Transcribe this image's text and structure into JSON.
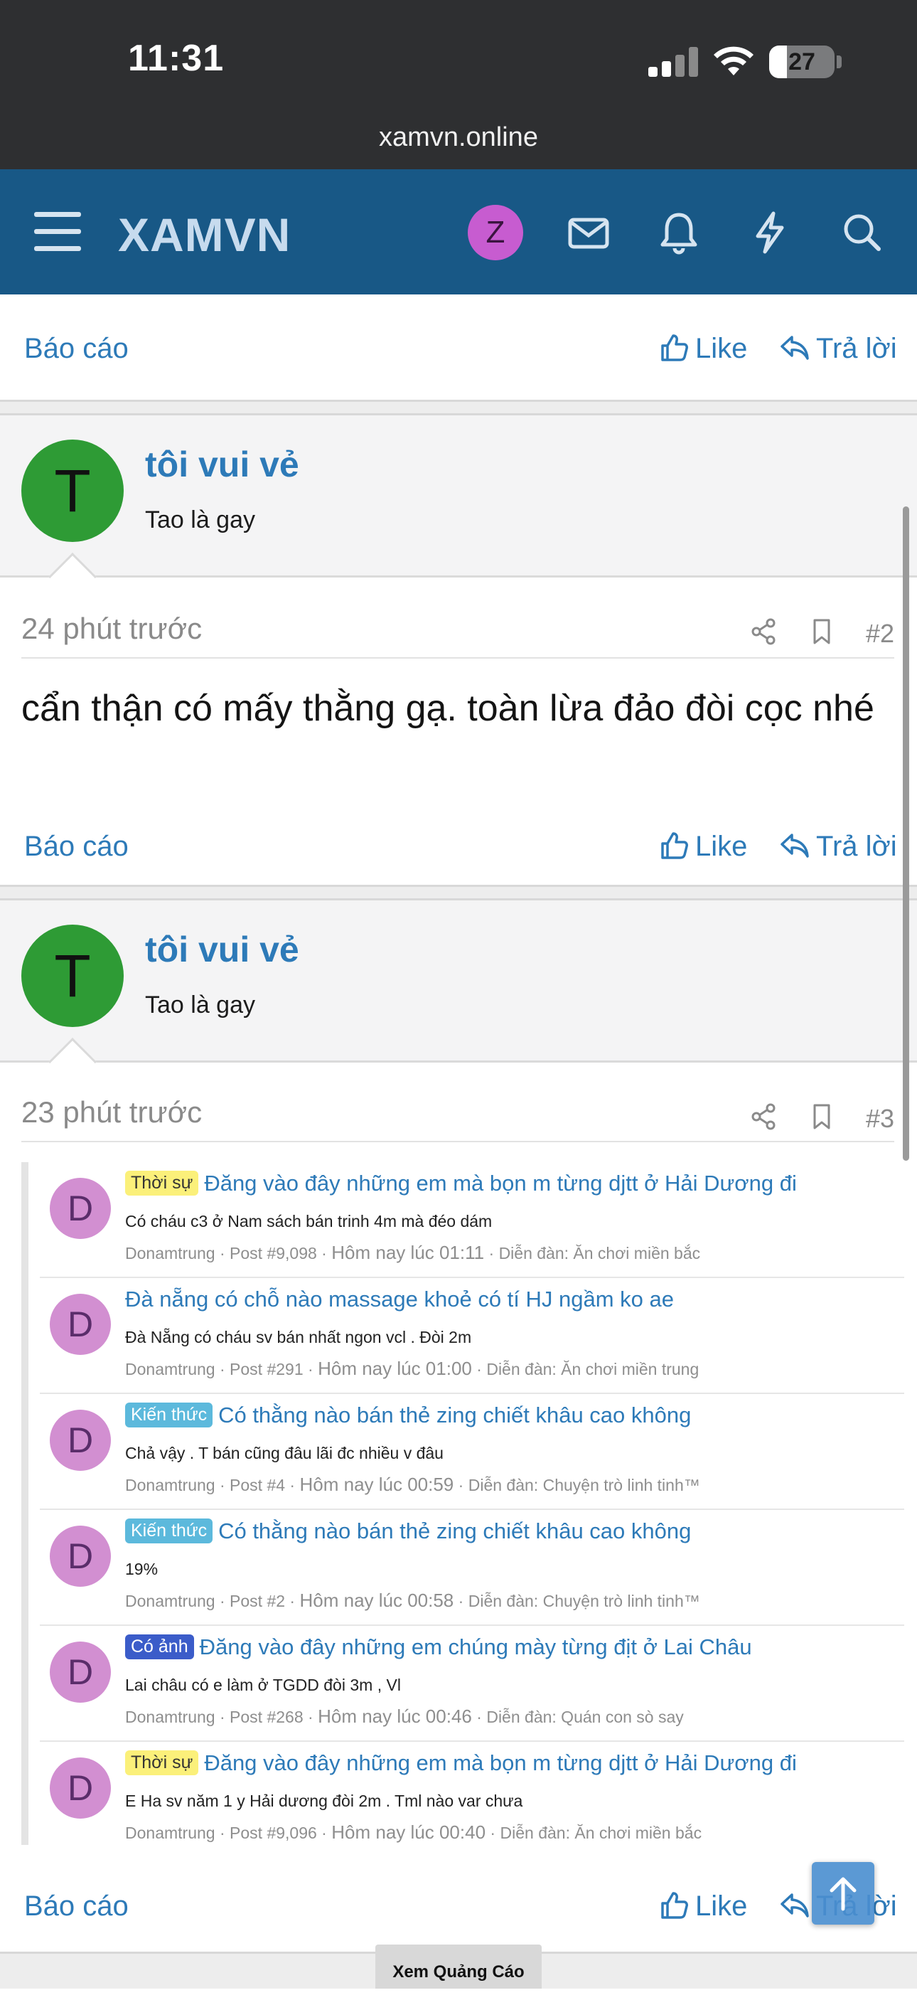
{
  "status": {
    "time": "11:31",
    "battery": "27"
  },
  "browser": {
    "url": "xamvn.online"
  },
  "header": {
    "logo": "XAMVN",
    "avatar_letter": "Z"
  },
  "actions": {
    "report": "Báo cáo",
    "like": "Like",
    "reply": "Trả lời"
  },
  "posts": [
    {
      "user": {
        "name": "tôi vui vẻ",
        "title": "Tao là gay",
        "avatar_letter": "T"
      },
      "time": "24 phút trước",
      "number": "#2",
      "body": "cẩn thận có mấy thằng gạ. toàn lừa đảo đòi cọc nhé"
    },
    {
      "user": {
        "name": "tôi vui vẻ",
        "title": "Tao là gay",
        "avatar_letter": "T"
      },
      "time": "23 phút trước",
      "number": "#3",
      "embed": [
        {
          "prefix": "Thời sự",
          "prefix_style": "thoisu",
          "title": "Đăng vào đây những em mà bọn m từng djtt ở Hải Dương đi",
          "snippet": "Có cháu c3 ở Nam sách bán trinh 4m mà đéo dám",
          "author": "Donamtrung",
          "post": "Post #9,098",
          "time": "Hôm nay lúc 01:11",
          "forum": "Diễn đàn: Ăn chơi miền bắc",
          "avatar_letter": "D"
        },
        {
          "prefix": "",
          "prefix_style": "",
          "title": "Đà nẵng có chỗ nào massage khoẻ có tí HJ ngầm ko ae",
          "snippet": "Đà Nẵng có cháu sv bán nhất ngon vcl . Đòi 2m",
          "author": "Donamtrung",
          "post": "Post #291",
          "time": "Hôm nay lúc 01:00",
          "forum": "Diễn đàn: Ăn chơi miền trung",
          "avatar_letter": "D"
        },
        {
          "prefix": "Kiến thức",
          "prefix_style": "kienthuc",
          "title": "Có thằng nào bán thẻ zing chiết khâu cao không",
          "snippet": "Chả vậy . T bán cũng đâu lãi đc nhiều v đâu",
          "author": "Donamtrung",
          "post": "Post #4",
          "time": "Hôm nay lúc 00:59",
          "forum": "Diễn đàn: Chuyện trò linh tinh™",
          "avatar_letter": "D"
        },
        {
          "prefix": "Kiến thức",
          "prefix_style": "kienthuc",
          "title": "Có thằng nào bán thẻ zing chiết khâu cao không",
          "snippet": "19%",
          "author": "Donamtrung",
          "post": "Post #2",
          "time": "Hôm nay lúc 00:58",
          "forum": "Diễn đàn: Chuyện trò linh tinh™",
          "avatar_letter": "D"
        },
        {
          "prefix": "Có ảnh",
          "prefix_style": "coanh",
          "title": "Đăng vào đây những em chúng mày từng địt ở Lai Châu",
          "snippet": "Lai châu có e làm ở TGDD đòi 3m , Vl",
          "author": "Donamtrung",
          "post": "Post #268",
          "time": "Hôm nay lúc 00:46",
          "forum": "Diễn đàn: Quán con sò say",
          "avatar_letter": "D"
        },
        {
          "prefix": "Thời sự",
          "prefix_style": "thoisu",
          "title": "Đăng vào đây những em mà bọn m từng djtt ở Hải Dương đi",
          "snippet": "E Ha sv năm 1 y Hải dương đòi 2m . Tml nào var chưa",
          "author": "Donamtrung",
          "post": "Post #9,096",
          "time": "Hôm nay lúc 00:40",
          "forum": "Diễn đàn: Ăn chơi miền bắc",
          "avatar_letter": "D"
        }
      ]
    }
  ],
  "ad": {
    "label": "Xem Quảng Cáo"
  }
}
